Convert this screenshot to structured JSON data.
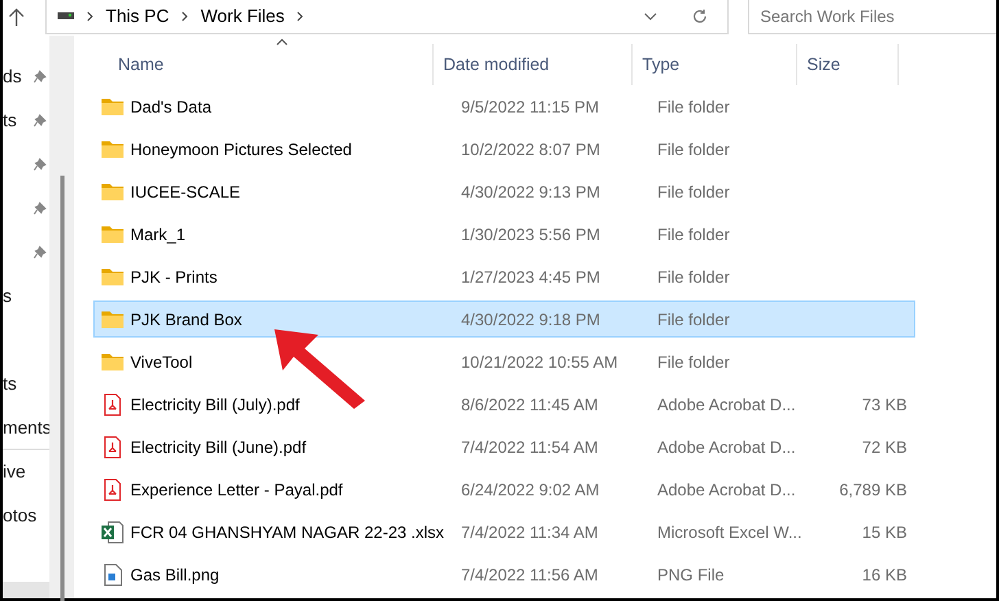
{
  "address_bar": {
    "path": [
      "This PC",
      "Work Files"
    ]
  },
  "search": {
    "placeholder": "Search Work Files"
  },
  "sidebar": {
    "items": [
      {
        "label": "ds",
        "pinned": true
      },
      {
        "label": "ts",
        "pinned": true
      },
      {
        "pinned": true
      },
      {
        "pinned": true
      },
      {
        "pinned": true
      },
      {
        "label": "s",
        "pinned": false
      },
      {
        "pinned": false
      },
      {
        "label": "ts",
        "pinned": false
      },
      {
        "label": "ments",
        "pinned": false
      },
      {
        "label": "ive",
        "pinned": false
      },
      {
        "label": "otos",
        "pinned": false
      }
    ]
  },
  "table": {
    "columns": [
      "Name",
      "Date modified",
      "Type",
      "Size"
    ],
    "rows": [
      {
        "kind": "folder",
        "name": "Dad's Data",
        "date": "9/5/2022 11:15 PM",
        "type": "File folder",
        "size": "",
        "selected": false
      },
      {
        "kind": "folder",
        "name": "Honeymoon Pictures Selected",
        "date": "10/2/2022 8:07 PM",
        "type": "File folder",
        "size": "",
        "selected": false
      },
      {
        "kind": "folder",
        "name": "IUCEE-SCALE",
        "date": "4/30/2022 9:13 PM",
        "type": "File folder",
        "size": "",
        "selected": false
      },
      {
        "kind": "folder",
        "name": "Mark_1",
        "date": "1/30/2023 5:56 PM",
        "type": "File folder",
        "size": "",
        "selected": false
      },
      {
        "kind": "folder",
        "name": "PJK - Prints",
        "date": "1/27/2023 4:45 PM",
        "type": "File folder",
        "size": "",
        "selected": false
      },
      {
        "kind": "folder",
        "name": "PJK Brand Box",
        "date": "4/30/2022 9:18 PM",
        "type": "File folder",
        "size": "",
        "selected": true
      },
      {
        "kind": "folder",
        "name": "ViveTool",
        "date": "10/21/2022 10:55 AM",
        "type": "File folder",
        "size": "",
        "selected": false
      },
      {
        "kind": "pdf",
        "name": "Electricity Bill (July).pdf",
        "date": "8/6/2022 11:45 AM",
        "type": "Adobe Acrobat D...",
        "size": "73 KB",
        "selected": false
      },
      {
        "kind": "pdf",
        "name": "Electricity Bill (June).pdf",
        "date": "7/4/2022 11:54 AM",
        "type": "Adobe Acrobat D...",
        "size": "72 KB",
        "selected": false
      },
      {
        "kind": "pdf",
        "name": "Experience Letter - Payal.pdf",
        "date": "6/24/2022 9:02 AM",
        "type": "Adobe Acrobat D...",
        "size": "6,789 KB",
        "selected": false
      },
      {
        "kind": "excel",
        "name": "FCR 04 GHANSHYAM NAGAR 22-23 .xlsx",
        "date": "7/4/2022 11:34 AM",
        "type": "Microsoft Excel W...",
        "size": "15 KB",
        "selected": false
      },
      {
        "kind": "image",
        "name": "Gas Bill.png",
        "date": "7/4/2022 11:56 AM",
        "type": "PNG File",
        "size": "16 KB",
        "selected": false
      }
    ]
  }
}
